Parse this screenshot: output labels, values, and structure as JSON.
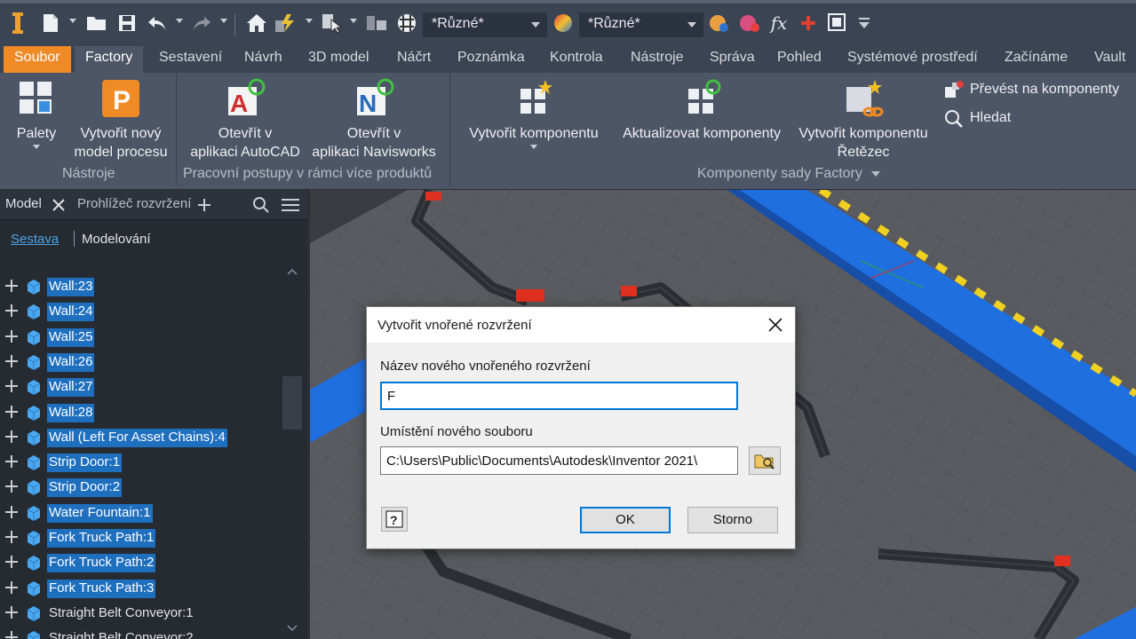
{
  "qat": {
    "style_combo": "*Různé*",
    "appearance_combo": "*Různé*"
  },
  "tabs": [
    "Soubor",
    "Factory",
    "Sestavení",
    "Návrh",
    "3D model",
    "Náčrt",
    "Poznámka",
    "Kontrola",
    "Nástroje",
    "Správa",
    "Pohled",
    "Systémové prostředí",
    "Začínáme",
    "Vault"
  ],
  "ribbon": {
    "palety": "Palety",
    "novy_model": [
      "Vytvořit nový",
      "model procesu"
    ],
    "autocad": [
      "Otevřít v",
      "aplikaci AutoCAD"
    ],
    "navisworks": [
      "Otevřít v",
      "aplikaci Navisworks"
    ],
    "vytvorit_komponentu": "Vytvořit komponentu",
    "aktualizovat": "Aktualizovat komponenty",
    "retezec": [
      "Vytvořit komponentu",
      "Řetězec"
    ],
    "prevest": "Převést na komponenty",
    "hledat": "Hledat",
    "panel_nastroje": "Nástroje",
    "panel_pracovni": "Pracovní postupy v rámci více produktů",
    "panel_komponenty": "Komponenty sady Factory"
  },
  "browser": {
    "tab_model": "Model",
    "tab_layout": "Prohlížeč rozvržení",
    "mode_sestava": "Sestava",
    "mode_modelovani": "Modelování",
    "items": [
      {
        "label": "Wall:23",
        "selected": true
      },
      {
        "label": "Wall:24",
        "selected": true
      },
      {
        "label": "Wall:25",
        "selected": true
      },
      {
        "label": "Wall:26",
        "selected": true
      },
      {
        "label": "Wall:27",
        "selected": true
      },
      {
        "label": "Wall:28",
        "selected": true
      },
      {
        "label": "Wall (Left For Asset Chains):4",
        "selected": true
      },
      {
        "label": "Strip Door:1",
        "selected": true
      },
      {
        "label": "Strip Door:2",
        "selected": true
      },
      {
        "label": "Water Fountain:1",
        "selected": true
      },
      {
        "label": "Fork Truck Path:1",
        "selected": true
      },
      {
        "label": "Fork Truck Path:2",
        "selected": true
      },
      {
        "label": "Fork Truck Path:3",
        "selected": true
      },
      {
        "label": "Straight Belt Conveyor:1",
        "selected": false
      },
      {
        "label": "Straight Belt Conveyor:2",
        "selected": false
      }
    ]
  },
  "dialog": {
    "title": "Vytvořit vnořené rozvržení",
    "name_label": "Název nového vnořeného rozvržení",
    "name_value": "F",
    "location_label": "Umístění nového souboru",
    "location_value": "C:\\Users\\Public\\Documents\\Autodesk\\Inventor 2021\\",
    "ok": "OK",
    "cancel": "Storno"
  }
}
